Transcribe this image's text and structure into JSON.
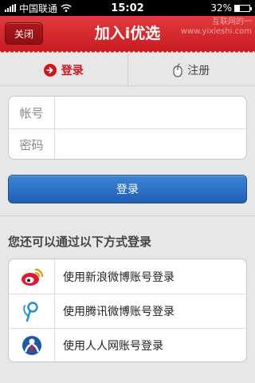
{
  "status_bar": {
    "carrier": "中国联通",
    "time": "15:02",
    "battery": "32%",
    "battery_level": 0.32
  },
  "watermark": {
    "line1": "互联网的一",
    "line2": "www.yixieshi.com"
  },
  "nav": {
    "close_label": "关闭",
    "title": "加入i优选"
  },
  "tabs": [
    {
      "label": "登录",
      "icon": "arrow-right-circle-icon",
      "active": true
    },
    {
      "label": "注册",
      "icon": "mouse-icon",
      "active": false
    }
  ],
  "form": {
    "account_label": "帐号",
    "account_value": "",
    "password_label": "密码",
    "password_value": ""
  },
  "login_button": "登录",
  "alt_login": {
    "heading": "您还可以通过以下方式登录",
    "items": [
      {
        "label": "使用新浪微博账号登录",
        "icon": "sina-weibo-icon"
      },
      {
        "label": "使用腾讯微博账号登录",
        "icon": "tencent-weibo-icon"
      },
      {
        "label": "使用人人网账号登录",
        "icon": "renren-icon"
      }
    ]
  },
  "colors": {
    "brand_red": "#d0161c",
    "button_blue": "#2a6fc4",
    "background": "#e7e7e7"
  }
}
